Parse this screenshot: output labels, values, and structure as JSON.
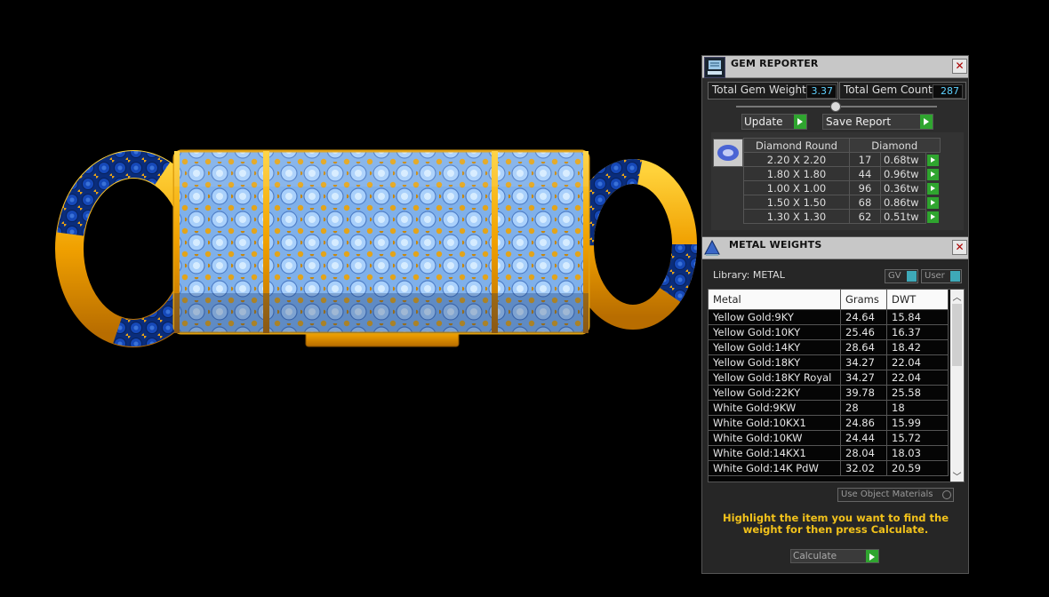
{
  "gem_reporter": {
    "title": "GEM REPORTER",
    "total_gem_weight_label": "Total Gem Weight",
    "total_gem_weight": "3.37",
    "total_gem_count_label": "Total Gem Count",
    "total_gem_count": "287",
    "update_label": "Update",
    "save_report_label": "Save Report",
    "table_headers": [
      "Diamond Round",
      "Diamond"
    ],
    "rows": [
      {
        "size": "2.20 X 2.20",
        "count": "17",
        "tw": "0.68tw"
      },
      {
        "size": "1.80 X 1.80",
        "count": "44",
        "tw": "0.96tw"
      },
      {
        "size": "1.00 X 1.00",
        "count": "96",
        "tw": "0.36tw"
      },
      {
        "size": "1.50 X 1.50",
        "count": "68",
        "tw": "0.86tw"
      },
      {
        "size": "1.30 X 1.30",
        "count": "62",
        "tw": "0.51tw"
      }
    ]
  },
  "metal_weights": {
    "title": "METAL WEIGHTS",
    "library_label": "Library: METAL",
    "gv_label": "GV",
    "user_label": "User",
    "columns": [
      "Metal",
      "Grams",
      "DWT"
    ],
    "rows": [
      {
        "metal": "Yellow Gold:9KY",
        "grams": "24.64",
        "dwt": "15.84"
      },
      {
        "metal": "Yellow Gold:10KY",
        "grams": "25.46",
        "dwt": "16.37"
      },
      {
        "metal": "Yellow Gold:14KY",
        "grams": "28.64",
        "dwt": "18.42"
      },
      {
        "metal": "Yellow Gold:18KY",
        "grams": "34.27",
        "dwt": "22.04"
      },
      {
        "metal": "Yellow Gold:18KY Royal",
        "grams": "34.27",
        "dwt": "22.04"
      },
      {
        "metal": "Yellow Gold:22KY",
        "grams": "39.78",
        "dwt": "25.58"
      },
      {
        "metal": "White Gold:9KW",
        "grams": "28",
        "dwt": "18"
      },
      {
        "metal": "White Gold:10KX1",
        "grams": "24.86",
        "dwt": "15.99"
      },
      {
        "metal": "White Gold:10KW",
        "grams": "24.44",
        "dwt": "15.72"
      },
      {
        "metal": "White Gold:14KX1",
        "grams": "28.04",
        "dwt": "18.03"
      },
      {
        "metal": "White Gold:14K PdW",
        "grams": "32.02",
        "dwt": "20.59"
      }
    ],
    "use_object_materials_label": "Use Object Materials",
    "instruction": "Highlight the item you want to find the weight for then press Calculate.",
    "calculate_label": "Calculate"
  },
  "colors": {
    "accent_green": "#2fa52f",
    "value_cyan": "#5fd2ff",
    "instruction_yellow": "#f2c21b",
    "gold": "#f0a800",
    "sapphire": "#0d3a9a",
    "diamond": "#8fbef5"
  }
}
